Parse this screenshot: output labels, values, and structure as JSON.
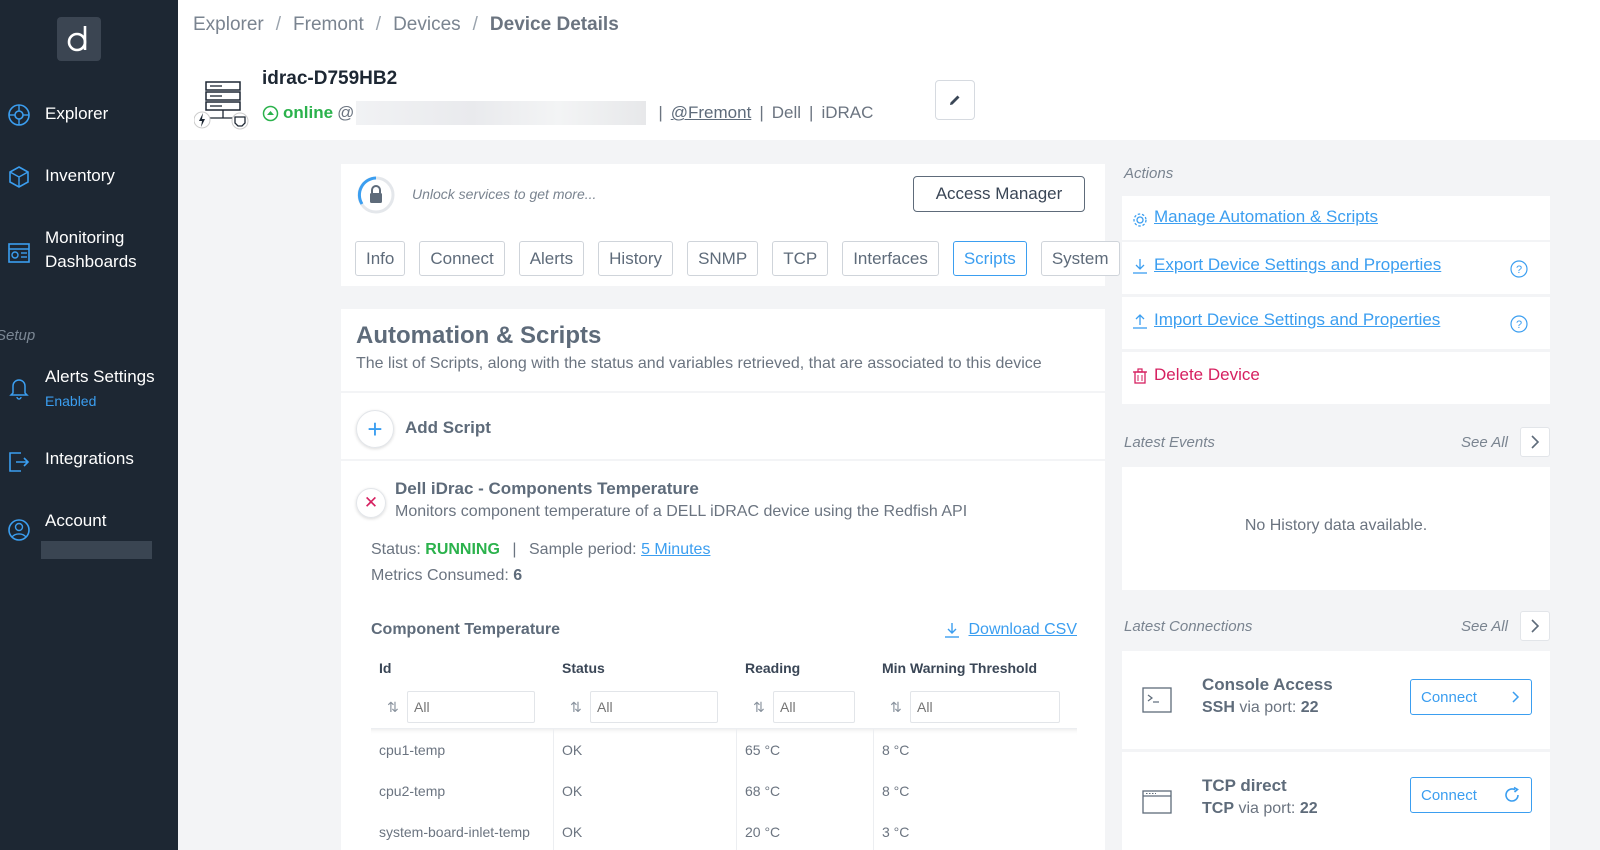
{
  "sidebar": {
    "logo": "d",
    "items": [
      {
        "label": "Explorer",
        "icon": "explorer-icon"
      },
      {
        "label": "Inventory",
        "icon": "inventory-icon"
      },
      {
        "label": "Monitoring Dashboards",
        "icon": "dashboard-icon"
      },
      {
        "label": "Alerts Settings",
        "sub": "Enabled",
        "icon": "bell-icon"
      },
      {
        "label": "Integrations",
        "icon": "integrations-icon"
      },
      {
        "label": "Account",
        "icon": "account-icon"
      }
    ],
    "setup_label": "Setup"
  },
  "breadcrumb": [
    "Explorer",
    "Fremont",
    "Devices",
    "Device Details"
  ],
  "device": {
    "name": "idrac-D759HB2",
    "status": "online",
    "at": "@",
    "site": "@Fremont",
    "vendor": "Dell",
    "type": "iDRAC"
  },
  "unlock": {
    "text": "Unlock services to get more...",
    "button": "Access Manager"
  },
  "tabs": [
    {
      "label": "Info",
      "active": false
    },
    {
      "label": "Connect",
      "active": false
    },
    {
      "label": "Alerts",
      "active": false
    },
    {
      "label": "History",
      "active": false
    },
    {
      "label": "SNMP",
      "active": false
    },
    {
      "label": "TCP",
      "active": false
    },
    {
      "label": "Interfaces",
      "active": false
    },
    {
      "label": "Scripts",
      "active": true
    },
    {
      "label": "System",
      "active": false
    }
  ],
  "scripts": {
    "title": "Automation & Scripts",
    "description": "The list of Scripts, along with the status and variables retrieved, that are associated to this device",
    "add_label": "Add Script",
    "item": {
      "name": "Dell iDrac - Components Temperature",
      "description": "Monitors component temperature of a DELL iDRAC device using the Redfish API",
      "status_label": "Status:",
      "status_value": "RUNNING",
      "sample_label": "Sample period:",
      "sample_value": "5 Minutes",
      "metrics_label": "Metrics Consumed:",
      "metrics_value": "6",
      "table_title": "Component Temperature",
      "download_label": "Download CSV",
      "columns": [
        "Id",
        "Status",
        "Reading",
        "Min Warning Threshold"
      ],
      "filter_placeholder": "All",
      "rows": [
        [
          "cpu1-temp",
          "OK",
          "65 °C",
          "8 °C"
        ],
        [
          "cpu2-temp",
          "OK",
          "68 °C",
          "8 °C"
        ],
        [
          "system-board-inlet-temp",
          "OK",
          "20 °C",
          "3 °C"
        ]
      ]
    }
  },
  "actions": {
    "label": "Actions",
    "items": [
      {
        "label": "Manage Automation & Scripts",
        "icon": "gear-icon"
      },
      {
        "label": "Export Device Settings and Properties",
        "icon": "download-icon",
        "help": true
      },
      {
        "label": "Import Device Settings and Properties",
        "icon": "upload-icon",
        "help": true
      },
      {
        "label": "Delete Device",
        "icon": "trash-icon"
      }
    ]
  },
  "events": {
    "label": "Latest Events",
    "see_all": "See All",
    "empty": "No History data available."
  },
  "connections": {
    "label": "Latest Connections",
    "see_all": "See All",
    "items": [
      {
        "title": "Console Access",
        "proto": "SSH",
        "via": "via port:",
        "port": "22",
        "button": "Connect",
        "icon": "terminal-icon"
      },
      {
        "title": "TCP direct",
        "proto": "TCP",
        "via": "via port:",
        "port": "22",
        "button": "Connect",
        "icon": "browser-window-icon"
      }
    ]
  },
  "colors": {
    "sidebar": "#1d2733",
    "accent": "#3b9ef0",
    "online": "#2bb24c",
    "danger": "#d62060"
  }
}
